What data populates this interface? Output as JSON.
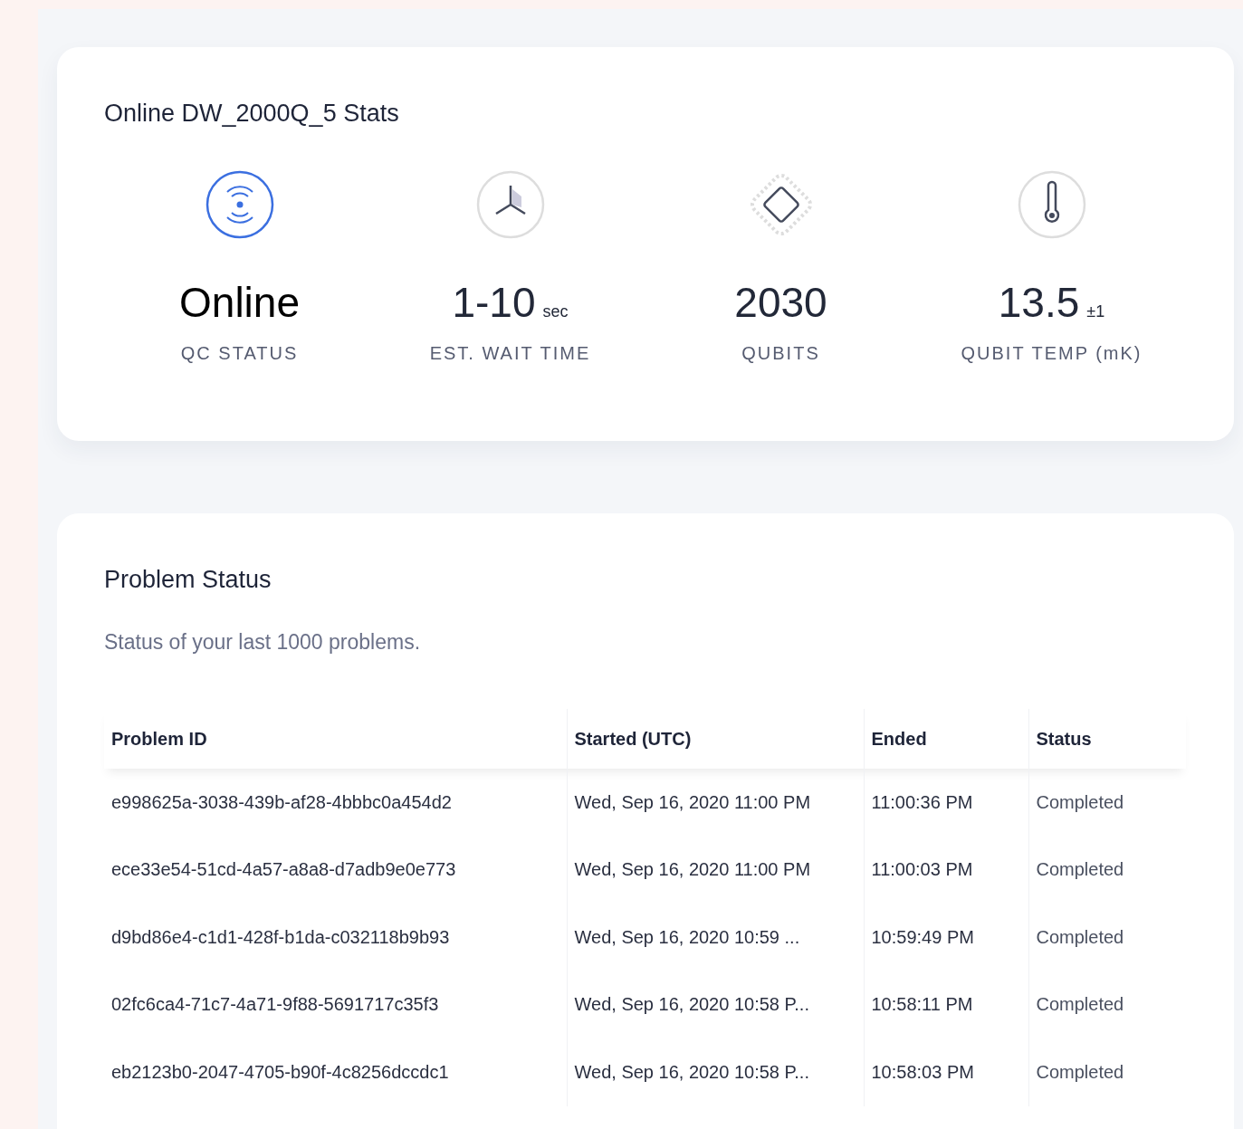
{
  "stats_card": {
    "title": "Online DW_2000Q_5 Stats",
    "stats": [
      {
        "kind": "signal",
        "value": "Online",
        "label": "QC STATUS",
        "active": true
      },
      {
        "kind": "fan",
        "value": "1-10",
        "unit": "sec",
        "label": "EST. WAIT TIME",
        "active": false
      },
      {
        "kind": "chip",
        "value": "2030",
        "label": "QUBITS",
        "active": false
      },
      {
        "kind": "thermometer",
        "value": "13.5",
        "unit": "±1",
        "label": "QUBIT TEMP (mK)",
        "active": false
      }
    ]
  },
  "problem_status": {
    "title": "Problem Status",
    "subtitle": "Status of your last 1000 problems.",
    "table": {
      "columns": [
        "Problem ID",
        "Started (UTC)",
        "Ended",
        "Status"
      ],
      "rows": [
        [
          "e998625a-3038-439b-af28-4bbbc0a454d2",
          "Wed, Sep 16, 2020 11:00 PM",
          "11:00:36 PM",
          "Completed"
        ],
        [
          "ece33e54-51cd-4a57-a8a8-d7adb9e0e773",
          "Wed, Sep 16, 2020 11:00 PM",
          "11:00:03 PM",
          "Completed"
        ],
        [
          "d9bd86e4-c1d1-428f-b1da-c032118b9b93",
          "Wed, Sep 16, 2020 10:59 ...",
          "10:59:49 PM",
          "Completed"
        ],
        [
          "02fc6ca4-71c7-4a71-9f88-5691717c35f3",
          "Wed, Sep 16, 2020 10:58 P...",
          "10:58:11 PM",
          "Completed"
        ],
        [
          "eb2123b0-2047-4705-b90f-4c8256dccdc1",
          "Wed, Sep 16, 2020 10:58 P...",
          "10:58:03 PM",
          "Completed"
        ]
      ]
    }
  }
}
